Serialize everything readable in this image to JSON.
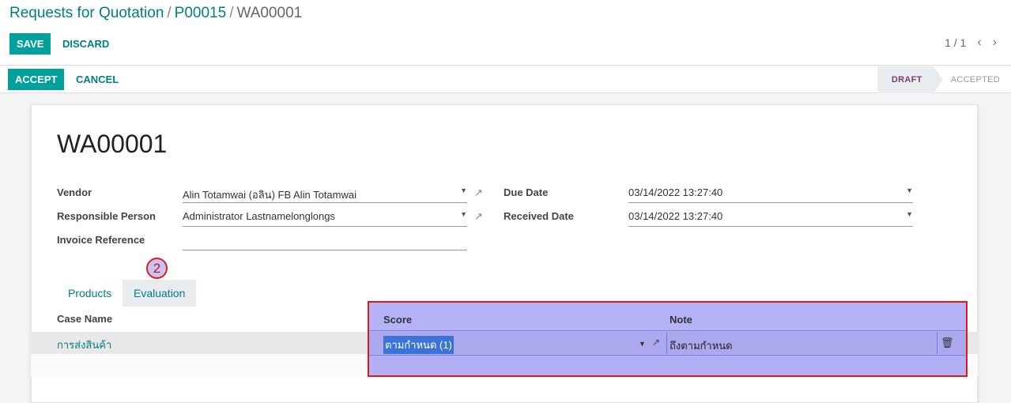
{
  "breadcrumb": {
    "part1": "Requests for Quotation",
    "part2": "P00015",
    "current": "WA00001",
    "sep": "/"
  },
  "toolbar": {
    "save_label": "SAVE",
    "discard_label": "DISCARD",
    "pager": "1 / 1",
    "prev_icon": "‹",
    "next_icon": "›"
  },
  "statusbar": {
    "accept_label": "ACCEPT",
    "cancel_label": "CANCEL",
    "stages": [
      "DRAFT",
      "ACCEPTED"
    ],
    "active_stage": "DRAFT"
  },
  "record": {
    "title": "WA00001",
    "vendor_label": "Vendor",
    "vendor_value": "Alin Totamwai (อลิน) FB Alin Totamwai",
    "responsible_label": "Responsible Person",
    "responsible_value": "Administrator Lastnamelonglongs",
    "invoice_label": "Invoice Reference",
    "invoice_value": "",
    "due_label": "Due Date",
    "due_value": "03/14/2022 13:27:40",
    "received_label": "Received Date",
    "received_value": "03/14/2022 13:27:40"
  },
  "annotation_badge": "2",
  "tabs": [
    "Products",
    "Evaluation"
  ],
  "active_tab": "Evaluation",
  "table": {
    "headers": [
      "Case Name",
      "Score",
      "Note"
    ],
    "rows": [
      {
        "case": "การส่งสินค้า",
        "score": "ตามกำหนด (1)",
        "note": "ถึงตามกำหนด"
      }
    ]
  },
  "icons": {
    "external": "external-link-icon",
    "caret": "caret-down-icon",
    "trash": "trash-icon"
  },
  "colors": {
    "primary": "#00a09d",
    "link": "#017e84",
    "highlight": "#7a72f0",
    "highlight_border": "#e01818"
  }
}
